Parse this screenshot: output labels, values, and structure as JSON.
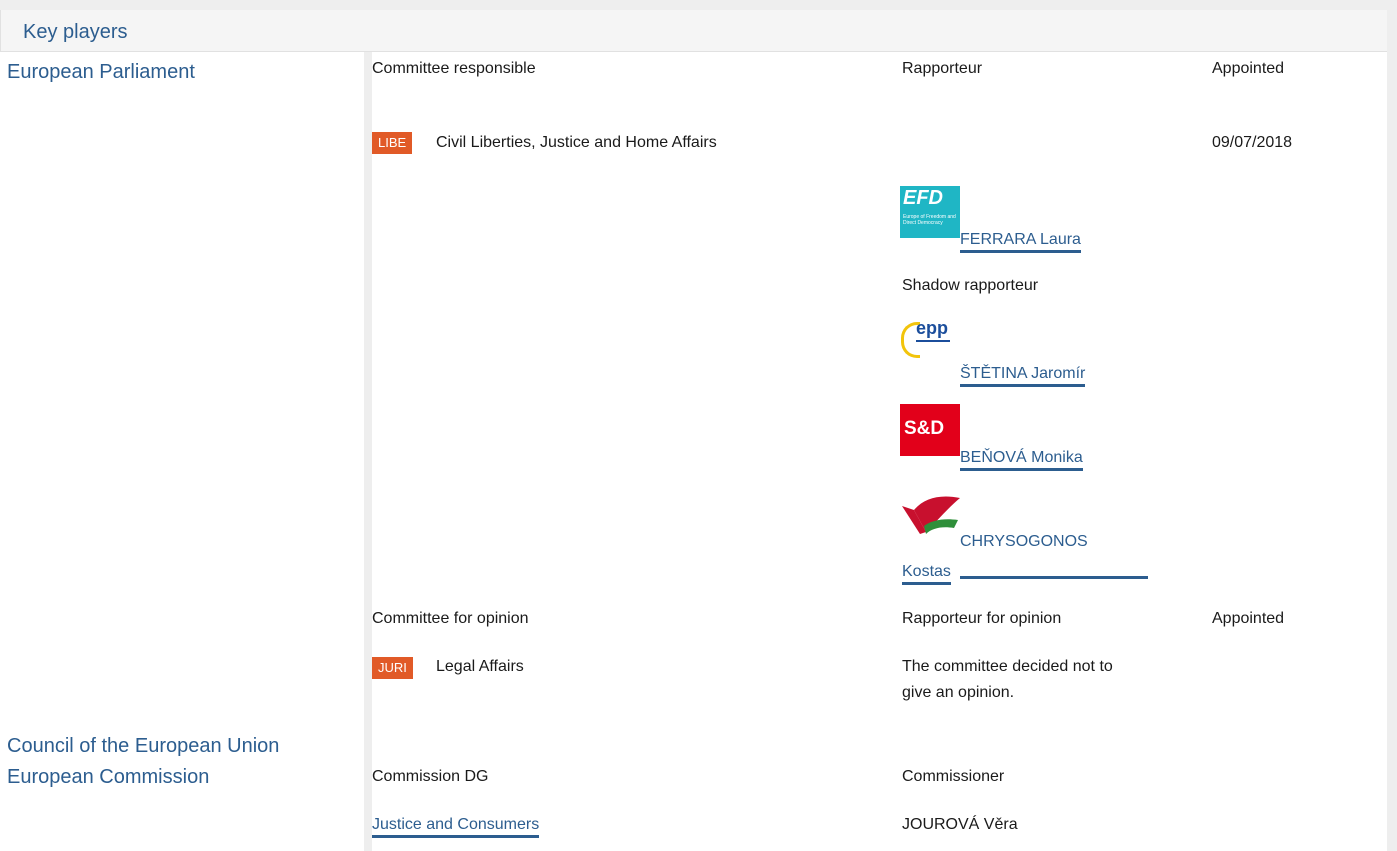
{
  "section": {
    "title": "Key players"
  },
  "institutions": {
    "parliament": "European Parliament",
    "council": "Council of the European Union",
    "commission": "European Commission"
  },
  "parliament": {
    "lead": {
      "header_committee": "Committee responsible",
      "header_rapporteur": "Rapporteur",
      "header_appointed": "Appointed",
      "committee_code": "LIBE",
      "committee_name": "Civil Liberties, Justice and Home Affairs",
      "appointed_date": "09/07/2018",
      "rapporteur": {
        "group_logo": "efdd-logo",
        "name": "FERRARA Laura"
      },
      "shadow_label": "Shadow rapporteur",
      "shadows": [
        {
          "group_logo": "epp-logo",
          "name": "ŠTĚTINA Jaromír"
        },
        {
          "group_logo": "s-and-d-logo",
          "name": "BEŇOVÁ Monika"
        },
        {
          "group_logo": "gue-ngl-logo",
          "name_line1": "CHRYSOGONOS",
          "name_line2": "Kostas"
        }
      ],
      "logo_text": {
        "efd": "EFD",
        "epp": "epp",
        "sd": "S&D"
      }
    },
    "opinion": {
      "header_committee": "Committee for opinion",
      "header_rapporteur": "Rapporteur for opinion",
      "header_appointed": "Appointed",
      "committee_code": "JURI",
      "committee_name": "Legal Affairs",
      "note_line1": "The committee decided not to",
      "note_line2": "give an opinion."
    }
  },
  "commission": {
    "header_dg": "Commission DG",
    "header_commissioner": "Commissioner",
    "dg": "Justice and Consumers",
    "commissioner": "JOUROVÁ Věra"
  },
  "colors": {
    "link": "#2c5d8f",
    "tag": "#e15a27",
    "panel": "#eeeeee"
  }
}
